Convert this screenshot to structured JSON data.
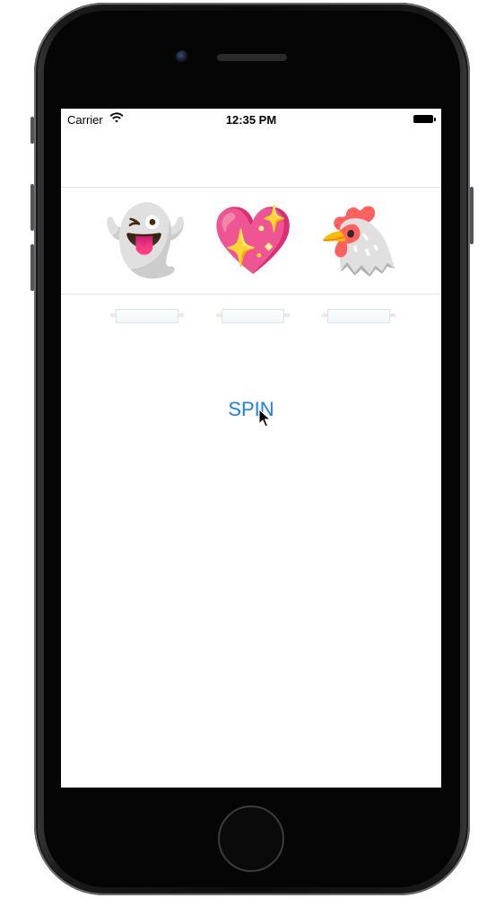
{
  "status_bar": {
    "carrier": "Carrier",
    "time": "12:35 PM",
    "wifi_icon": "wifi-icon",
    "battery_icon": "battery-icon"
  },
  "slot_machine": {
    "reels": [
      {
        "emoji": "👻",
        "icon": "ghost-icon"
      },
      {
        "emoji": "💖",
        "icon": "sparkling-heart-icon"
      },
      {
        "emoji": "🐔",
        "icon": "chicken-icon"
      }
    ]
  },
  "spin_button": {
    "label": "SPIN",
    "color": "#1a82e8"
  },
  "colors": {
    "screen_background": "#ffffff",
    "device_frame": "#0b0b0b"
  }
}
